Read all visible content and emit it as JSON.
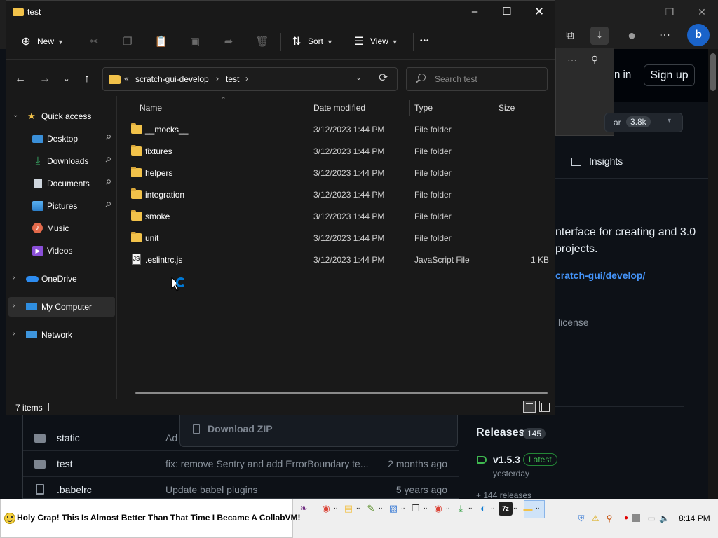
{
  "explorer": {
    "title": "test",
    "toolbar": {
      "new_label": "New",
      "sort_label": "Sort",
      "view_label": "View",
      "more_label": "•••"
    },
    "address": {
      "overflow": "«",
      "segments": [
        "scratch-gui-develop",
        "test"
      ],
      "separator": "›"
    },
    "search": {
      "placeholder": "Search test"
    },
    "sidebar": {
      "quick_access": "Quick access",
      "pinned": [
        {
          "label": "Desktop",
          "icon": "desktop-icon"
        },
        {
          "label": "Downloads",
          "icon": "download-arrow-icon"
        },
        {
          "label": "Documents",
          "icon": "documents-icon"
        },
        {
          "label": "Pictures",
          "icon": "pictures-icon"
        },
        {
          "label": "Music",
          "icon": "music-icon"
        },
        {
          "label": "Videos",
          "icon": "videos-icon"
        }
      ],
      "onedrive": "OneDrive",
      "my_computer": "My Computer",
      "network": "Network"
    },
    "columns": {
      "name": "Name",
      "date": "Date modified",
      "type": "Type",
      "size": "Size"
    },
    "files": [
      {
        "name": "__mocks__",
        "date": "3/12/2023 1:44 PM",
        "type": "File folder",
        "size": ""
      },
      {
        "name": "fixtures",
        "date": "3/12/2023 1:44 PM",
        "type": "File folder",
        "size": ""
      },
      {
        "name": "helpers",
        "date": "3/12/2023 1:44 PM",
        "type": "File folder",
        "size": ""
      },
      {
        "name": "integration",
        "date": "3/12/2023 1:44 PM",
        "type": "File folder",
        "size": ""
      },
      {
        "name": "smoke",
        "date": "3/12/2023 1:44 PM",
        "type": "File folder",
        "size": ""
      },
      {
        "name": "unit",
        "date": "3/12/2023 1:44 PM",
        "type": "File folder",
        "size": ""
      },
      {
        "name": ".eslintrc.js",
        "date": "3/12/2023 1:44 PM",
        "type": "JavaScript File",
        "size": "1 KB"
      }
    ],
    "status": {
      "item_count": "7 items"
    }
  },
  "browser": {
    "signin": "n in",
    "signup": "Sign up",
    "star_label": "ar",
    "star_count": "3.8k",
    "insights": "Insights",
    "about_desc": "nterface for creating and 3.0 projects.",
    "about_link": "cratch-gui/develop/",
    "license": "license",
    "download_zip": "Download ZIP",
    "file_rows": [
      {
        "name": "static",
        "message": "Ad",
        "date": "",
        "kind": "folder"
      },
      {
        "name": "test",
        "message": "fix: remove Sentry and add ErrorBoundary te...",
        "date": "2 months ago",
        "kind": "folder"
      },
      {
        "name": ".babelrc",
        "message": "Update babel plugins",
        "date": "5 years ago",
        "kind": "file"
      }
    ],
    "releases": {
      "title": "Releases",
      "count": "145",
      "latest_version": "v1.5.3",
      "latest_badge": "Latest",
      "latest_date": "yesterday",
      "more": "+ 144 releases"
    }
  },
  "taskbar": {
    "banner": "Holy Crap! This Is Almost Better Than That Time I Became A CollabVM!",
    "clock": "8:14 PM",
    "apps": [
      {
        "icon": "visual-studio-icon",
        "color": "#68217a"
      },
      {
        "icon": "chrome-icon",
        "color": "#db4437"
      },
      {
        "icon": "file-manager-icon",
        "color": "#f2c24a"
      },
      {
        "icon": "notepad-icon",
        "color": "#5a8f29"
      },
      {
        "icon": "image-viewer-icon",
        "color": "#3a7bd5"
      },
      {
        "icon": "video-editor-icon",
        "color": "#333333"
      },
      {
        "icon": "chrome-icon",
        "color": "#db4437"
      },
      {
        "icon": "download-arrow-icon",
        "color": "#2e9e3e"
      },
      {
        "icon": "edge-icon",
        "color": "#0c7bd3"
      },
      {
        "icon": "7zip-icon",
        "color": "#222222"
      },
      {
        "icon": "explorer-folder-icon",
        "color": "#f2c24a"
      }
    ]
  }
}
